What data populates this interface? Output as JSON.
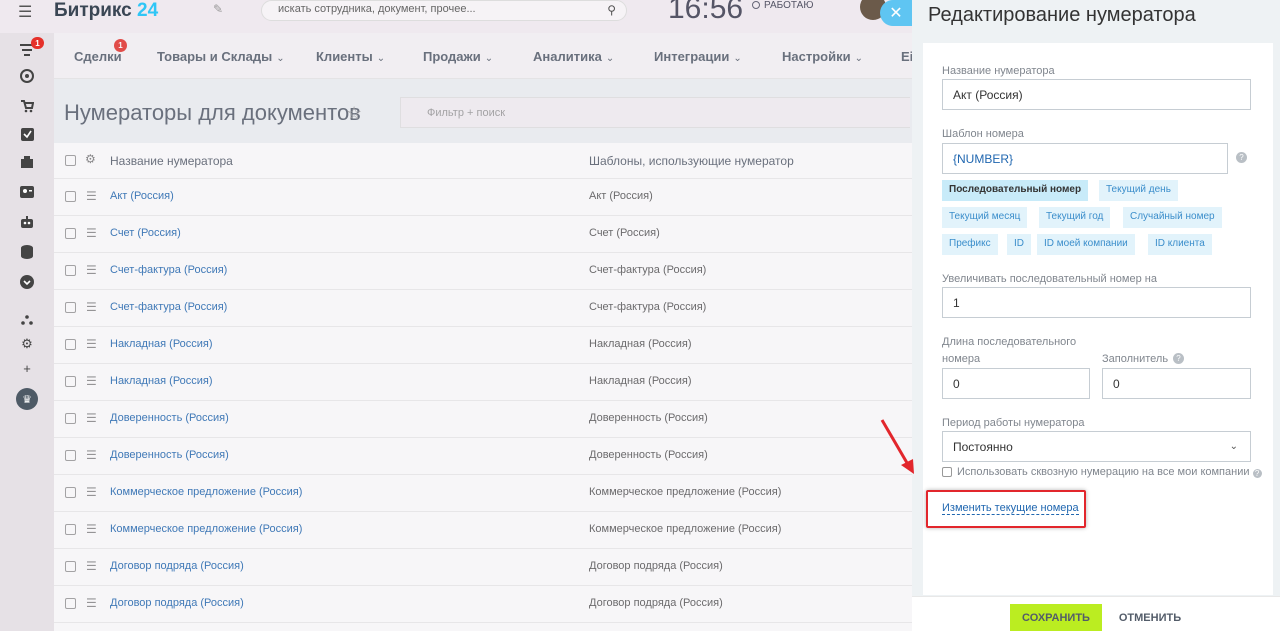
{
  "header": {
    "logo_name": "Битрикс",
    "logo_num": "24",
    "search_placeholder": "искать сотрудника, документ, прочее...",
    "clock": "16:56",
    "status": "РАБОТАЮ"
  },
  "leftbar": {
    "badge": "1"
  },
  "topmenu": {
    "items": [
      "Сделки",
      "Товары и Склады",
      "Клиенты",
      "Продажи",
      "Аналитика",
      "Интеграции",
      "Настройки",
      "Еі"
    ],
    "badge": "1"
  },
  "page": {
    "title": "Нумераторы для документов",
    "filter_placeholder": "Фильтр + поиск",
    "columns": [
      "Название нумератора",
      "Шаблоны, использующие нумератор"
    ],
    "rows": [
      [
        "Акт (Россия)",
        "Акт (Россия)"
      ],
      [
        "Счет (Россия)",
        "Счет (Россия)"
      ],
      [
        "Счет-фактура (Россия)",
        "Счет-фактура (Россия)"
      ],
      [
        "Счет-фактура (Россия)",
        "Счет-фактура (Россия)"
      ],
      [
        "Накладная (Россия)",
        "Накладная (Россия)"
      ],
      [
        "Накладная (Россия)",
        "Накладная (Россия)"
      ],
      [
        "Доверенность (Россия)",
        "Доверенность (Россия)"
      ],
      [
        "Доверенность (Россия)",
        "Доверенность (Россия)"
      ],
      [
        "Коммерческое предложение (Россия)",
        "Коммерческое предложение (Россия)"
      ],
      [
        "Коммерческое предложение (Россия)",
        "Коммерческое предложение (Россия)"
      ],
      [
        "Договор подряда (Россия)",
        "Договор подряда (Россия)"
      ],
      [
        "Договор подряда (Россия)",
        "Договор подряда (Россия)"
      ]
    ]
  },
  "panel": {
    "title": "Редактирование нумератора",
    "name_label": "Название нумератора",
    "name_value": "Акт (Россия)",
    "template_label": "Шаблон номера",
    "template_value": "{NUMBER}",
    "tags": [
      "Последовательный номер",
      "Текущий день",
      "Текущий месяц",
      "Текущий год",
      "Случайный номер",
      "Префикс",
      "ID",
      "ID моей компании",
      "ID клиента"
    ],
    "increment_label": "Увеличивать последовательный номер на",
    "increment_value": "1",
    "length_label_1": "Длина последовательного",
    "length_label_2": "номера",
    "length_value": "0",
    "filler_label": "Заполнитель",
    "filler_value": "0",
    "period_label": "Период работы нумератора",
    "period_value": "Постоянно",
    "checkbox_label": "Использовать сквозную нумерацию на все мои компании",
    "change_link": "Изменить текущие номера",
    "save": "СОХРАНИТЬ",
    "cancel": "ОТМЕНИТЬ"
  }
}
